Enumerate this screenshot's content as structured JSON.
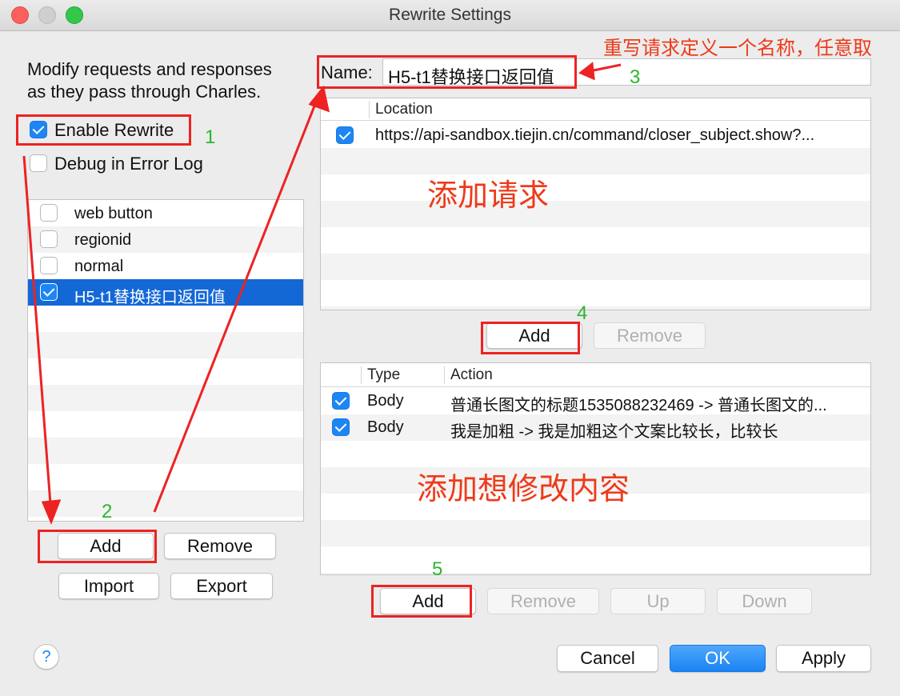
{
  "window": {
    "title": "Rewrite Settings"
  },
  "left": {
    "description_line1": "Modify requests and responses",
    "description_line2": "as they pass through Charles.",
    "enable_rewrite": {
      "label": "Enable Rewrite",
      "checked": true
    },
    "debug_error_log": {
      "label": "Debug in Error Log",
      "checked": false
    },
    "sets": [
      {
        "label": "web button",
        "checked": false
      },
      {
        "label": "regionid",
        "checked": false
      },
      {
        "label": "normal",
        "checked": false
      },
      {
        "label": "H5-t1替换接口返回值",
        "checked": true,
        "selected": true
      }
    ],
    "buttons": {
      "add": "Add",
      "remove": "Remove",
      "import": "Import",
      "export": "Export"
    }
  },
  "right": {
    "name_label": "Name:",
    "name_value": "H5-t1替换接口返回值",
    "locations": {
      "header": "Location",
      "rows": [
        {
          "checked": true,
          "location": "https://api-sandbox.tiejin.cn/command/closer_subject.show?..."
        }
      ],
      "buttons": {
        "add": "Add",
        "remove": "Remove"
      }
    },
    "rules": {
      "header_type": "Type",
      "header_action": "Action",
      "rows": [
        {
          "checked": true,
          "type": "Body",
          "action": "普通长图文的标题1535088232469 -> 普通长图文的..."
        },
        {
          "checked": true,
          "type": "Body",
          "action": "我是加粗 -> 我是加粗这个文案比较长，比较长"
        }
      ],
      "buttons": {
        "add": "Add",
        "remove": "Remove",
        "up": "Up",
        "down": "Down"
      }
    }
  },
  "footer": {
    "help": "?",
    "cancel": "Cancel",
    "ok": "OK",
    "apply": "Apply"
  },
  "annotations": {
    "name_note": "重写请求定义一个名称，任意取",
    "add_request": "添加请求",
    "add_modify": "添加想修改内容",
    "n1": "1",
    "n2": "2",
    "n3": "3",
    "n4": "4",
    "n5": "5"
  },
  "colors": {
    "accent": "#1d86f5",
    "selection": "#1468d6",
    "annotation_red": "#ee2222",
    "annotation_green": "#2db52d"
  }
}
